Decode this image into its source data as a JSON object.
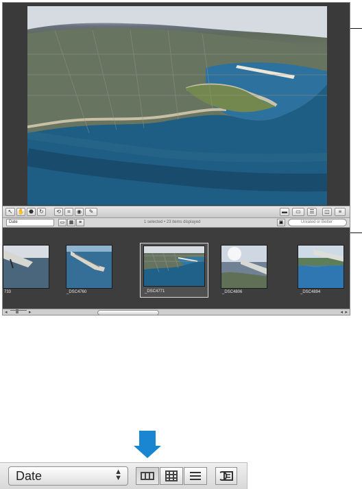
{
  "status": {
    "display_text": "1 selected • 23 items displayed",
    "filter_placeholder": "Unrated or Better"
  },
  "controls": {
    "sort_label": "Date",
    "zoom_sort_label": "Date"
  },
  "filmstrip": {
    "items": [
      {
        "label": "733",
        "selected": false
      },
      {
        "label": "_DSC4760",
        "selected": false
      },
      {
        "label": "_DSC4771",
        "selected": true
      },
      {
        "label": "_DSC4806",
        "selected": false
      },
      {
        "label": "_DSC4894",
        "selected": false
      }
    ]
  },
  "icons": {
    "selection": "cursor-icon",
    "crop": "crop-icon",
    "eye": "eye-icon",
    "brush": "brush-icon",
    "view_filmstrip": "filmstrip-view-icon",
    "view_grid": "grid-view-icon",
    "view_list": "list-view-icon",
    "filter": "filter-icon"
  },
  "colors": {
    "accent_arrow": "#1a86d1",
    "window_dark": "#3b3b3b",
    "toolbar_light": "#d8d8d8"
  }
}
